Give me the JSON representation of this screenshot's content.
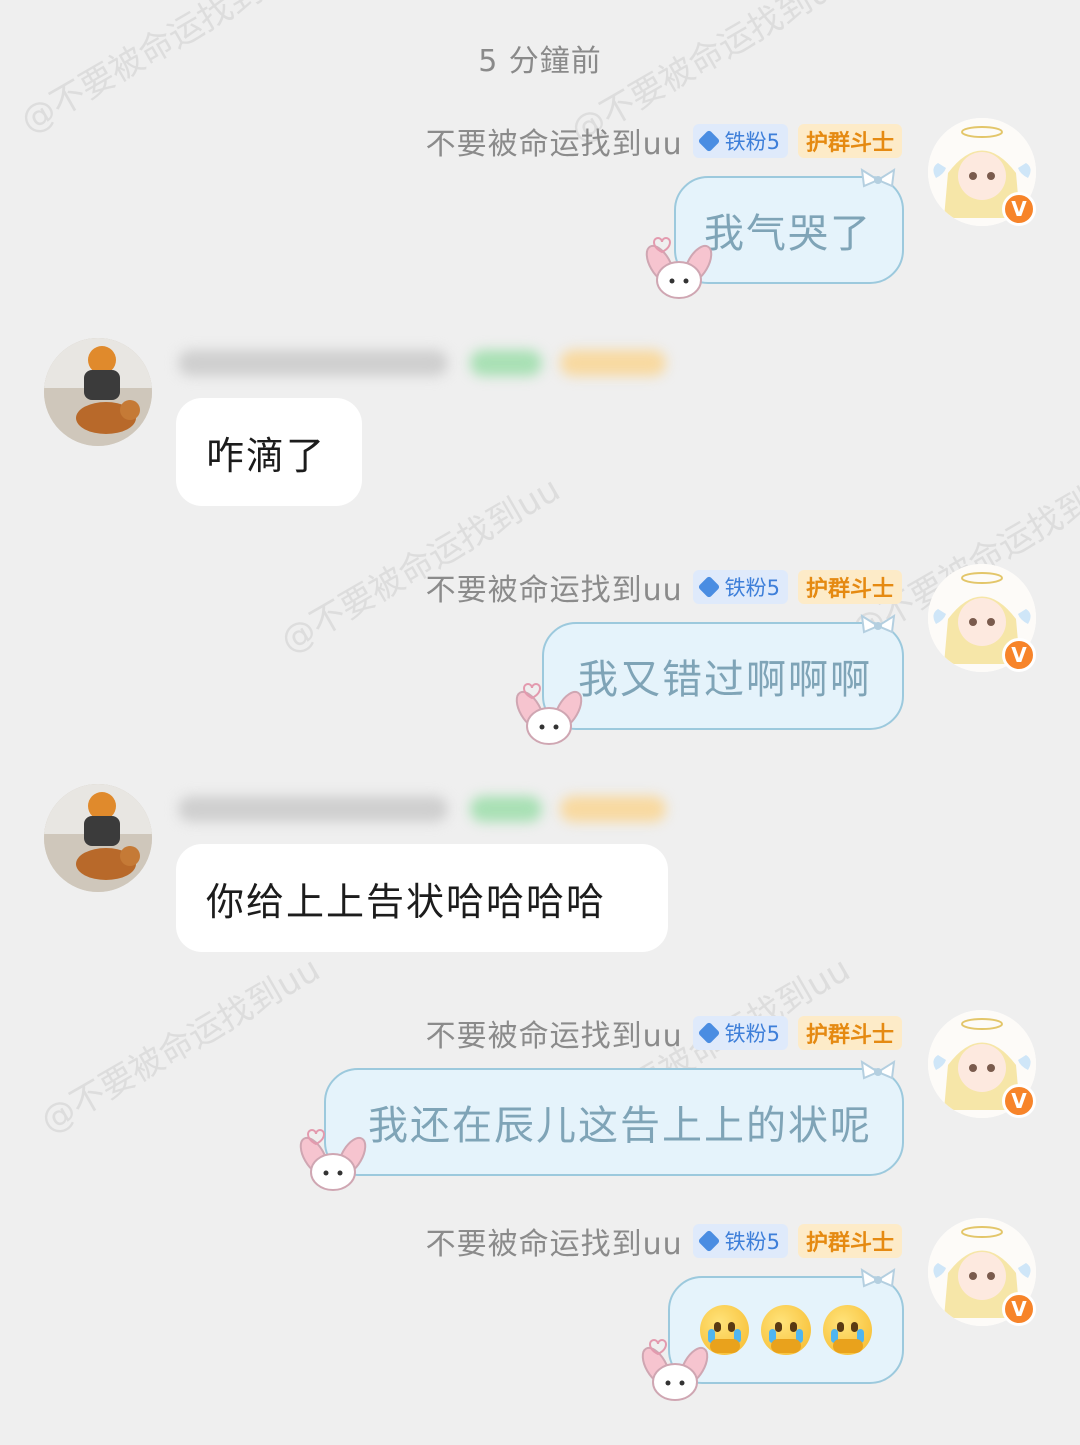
{
  "watermark_text": "@不要被命运找到uu",
  "timestamp": "5 分鐘前",
  "me": {
    "name": "不要被命运找到uu",
    "fan_badge": "铁粉5",
    "role_badge": "护群斗士",
    "verified_mark": "V"
  },
  "messages": [
    {
      "side": "right",
      "text": "我气哭了"
    },
    {
      "side": "left",
      "text": "咋滴了"
    },
    {
      "side": "right",
      "text": "我又错过啊啊啊"
    },
    {
      "side": "left",
      "text": "你给上上告状哈哈哈哈"
    },
    {
      "side": "right",
      "text": "我还在辰儿这告上上的状呢"
    },
    {
      "side": "right",
      "emoji": [
        "crying-face-icon",
        "crying-face-icon",
        "crying-face-icon"
      ]
    }
  ],
  "colors": {
    "background": "#efefef",
    "bubble_right_fill": "#e5f3fb",
    "bubble_right_border": "#9cc9dd",
    "bubble_left_fill": "#ffffff",
    "verified": "#f7842a",
    "fan_badge": "#3e7fd9",
    "role_badge": "#e58a12"
  }
}
